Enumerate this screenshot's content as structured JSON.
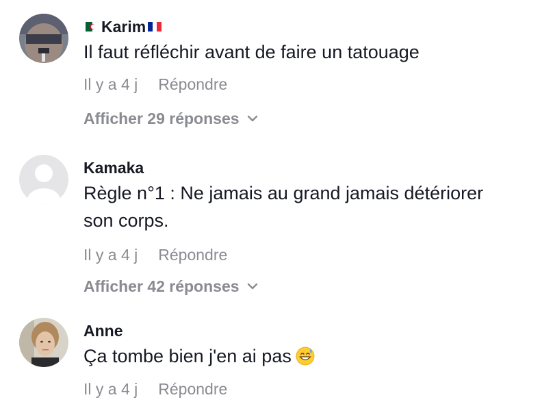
{
  "comments": [
    {
      "username": "Karim",
      "flags": [
        "algeria-flag-icon",
        "france-flag-icon"
      ],
      "text": "Il faut réfléchir avant de faire un tatouage",
      "time": "Il y a 4 j",
      "reply_label": "Répondre",
      "replies_label": "Afficher 29 réponses"
    },
    {
      "username": "Kamaka",
      "text_lines": [
        "Règle n°1 : Ne jamais au grand jamais détériorer",
        "son corps."
      ],
      "time": "Il y a 4 j",
      "reply_label": "Répondre",
      "replies_label": "Afficher 42 réponses"
    },
    {
      "username": "Anne",
      "text": "Ça tombe bien j'en ai pas",
      "emoji": "grinning-face-with-sweat-icon",
      "time": "Il y a 4 j",
      "reply_label": "Répondre"
    }
  ],
  "colors": {
    "text": "#161823",
    "muted": "#8a8b91",
    "background": "#ffffff"
  }
}
